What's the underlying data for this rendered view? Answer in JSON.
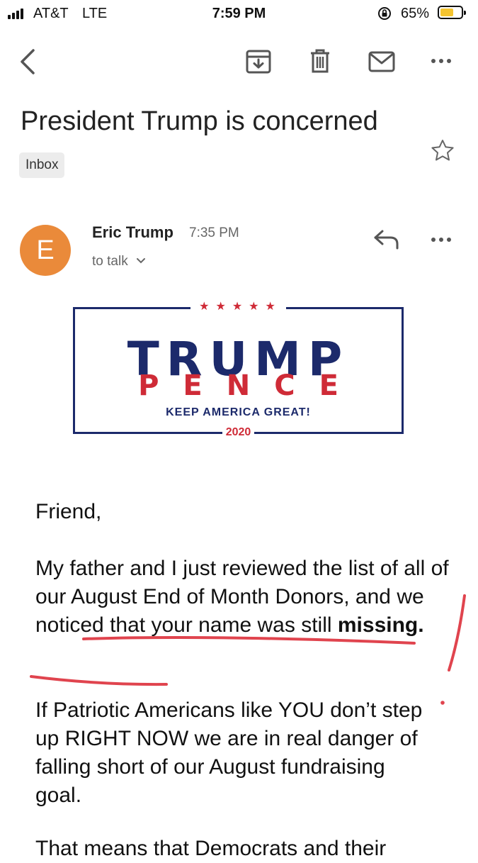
{
  "status_bar": {
    "carrier": "AT&T",
    "network": "LTE",
    "time": "7:59 PM",
    "battery_percent": "65%",
    "battery_level": 0.65
  },
  "toolbar": {
    "icons": [
      "back-arrow-icon",
      "archive-icon",
      "trash-icon",
      "mail-icon",
      "more-icon"
    ]
  },
  "email": {
    "subject": "President Trump is concerned",
    "label": "Inbox",
    "sender_initial": "E",
    "sender_name": "Eric Trump",
    "sent_time": "7:35 PM",
    "recipient": "to talk",
    "avatar_color": "#ea8a3a"
  },
  "banner": {
    "stars": "★★★★★",
    "line1": "TRUMP",
    "line2": "PENCE",
    "slogan": "KEEP AMERICA GREAT!",
    "year": "2020",
    "navy": "#1c2a6b",
    "red": "#cf2b37"
  },
  "body": {
    "greeting": "Friend,",
    "p1_text": "My father and I just reviewed the list of all of our August End of Month Donors, and we noticed that your name was still ",
    "p1_bold": "missing.",
    "p2": "If Patriotic Americans like YOU don’t step up RIGHT NOW we are in real danger of falling short of our August fundraising goal.",
    "p3_partial": "That means that Democrats and their"
  }
}
